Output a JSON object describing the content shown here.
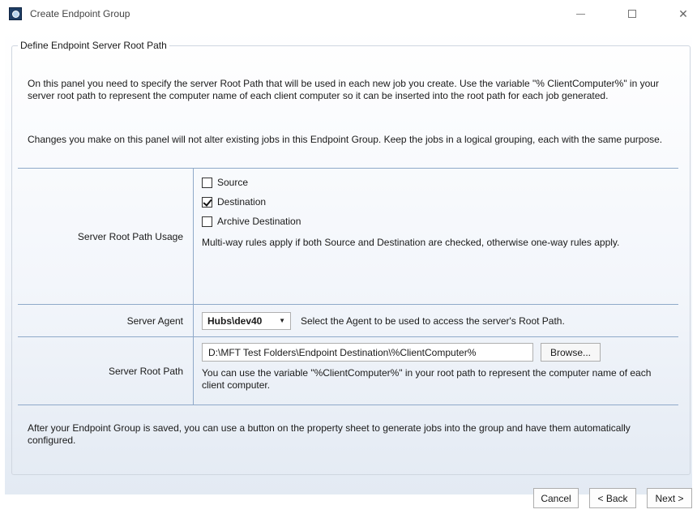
{
  "window": {
    "title": "Create Endpoint Group",
    "minimize_glyph": "—",
    "close_glyph": "✕"
  },
  "group": {
    "title": "Define Endpoint Server Root Path"
  },
  "intro": {
    "paragraph1": "On this panel you need to specify the server Root Path that will be used in each new job you create. Use the variable \"% ClientComputer%\" in your server root path to represent the computer name of each client computer so it can be inserted into the root path for each job generated.",
    "paragraph2": "Changes you make on this panel will not alter existing jobs in this Endpoint Group. Keep the jobs in a logical grouping, each with the same purpose."
  },
  "usage": {
    "label": "Server Root Path Usage",
    "options": [
      {
        "label": "Source",
        "checked": false
      },
      {
        "label": "Destination",
        "checked": true
      },
      {
        "label": "Archive Destination",
        "checked": false
      }
    ],
    "note": "Multi-way rules apply if both Source and Destination are checked, otherwise one-way rules apply."
  },
  "agent": {
    "label": "Server Agent",
    "selected": "Hubs\\dev40",
    "hint": "Select the Agent to be used to access the server's Root Path."
  },
  "root_path": {
    "label": "Server Root Path",
    "value": "D:\\MFT Test Folders\\Endpoint Destination\\%ClientComputer%",
    "browse_label": "Browse...",
    "note": "You can use the variable \"%ClientComputer%\" in your root path to represent the computer name of each client computer."
  },
  "footer_note": "After your Endpoint Group is saved, you can use a button on the property sheet to generate jobs into the group and have them automatically configured.",
  "buttons": {
    "cancel": "Cancel",
    "back": "< Back",
    "next": "Next >"
  }
}
